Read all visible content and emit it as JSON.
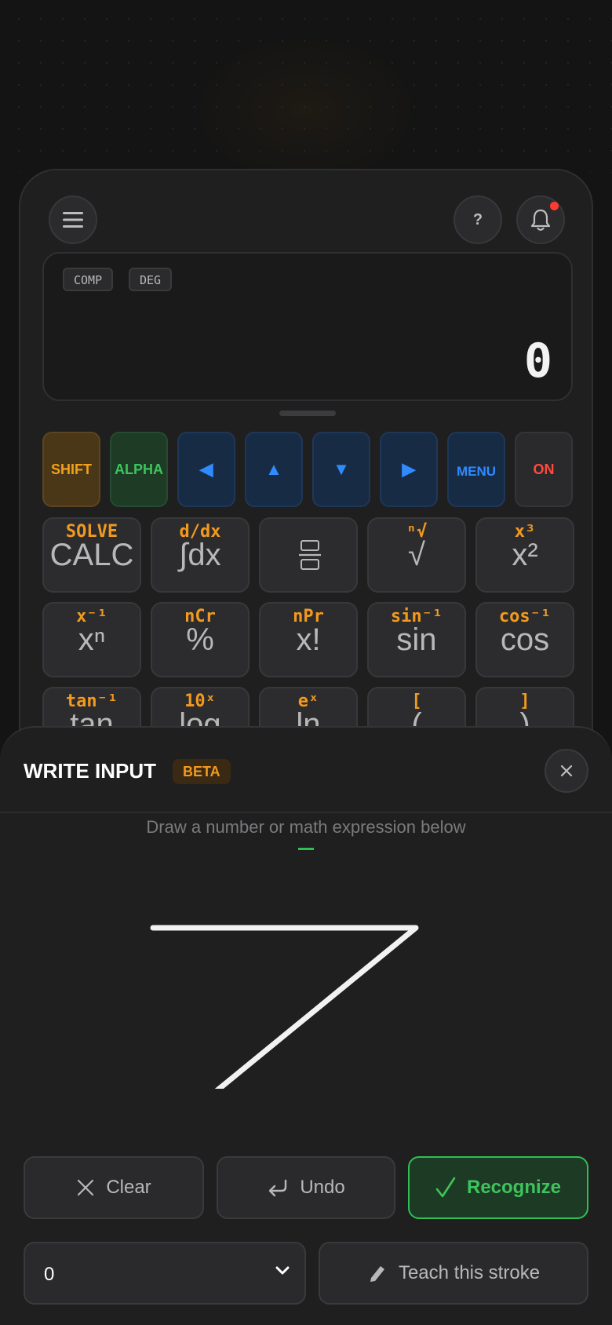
{
  "header": {
    "menu_icon": "hamburger-icon",
    "help_label": "?",
    "bell_icon": "bell-icon"
  },
  "display": {
    "mode_tags": [
      "COMP",
      "DEG"
    ],
    "value": "0"
  },
  "top_keys": [
    {
      "label": "SHIFT"
    },
    {
      "label": "ALPHA"
    },
    {
      "label": "◀"
    },
    {
      "label": "▲"
    },
    {
      "label": "▼"
    },
    {
      "label": "▶"
    },
    {
      "label": "MENU"
    },
    {
      "label": "ON"
    }
  ],
  "key_rows": [
    [
      {
        "sec": "SOLVE",
        "main": "CALC"
      },
      {
        "sec": "d/dx",
        "main": "∫dx"
      },
      {
        "sec": "",
        "main": ""
      },
      {
        "sec": "ⁿ√",
        "main": "√"
      },
      {
        "sec": "x³",
        "main": "x²"
      }
    ],
    [
      {
        "sec": "x⁻¹",
        "main": "xⁿ"
      },
      {
        "sec": "nCr",
        "main": "%"
      },
      {
        "sec": "nPr",
        "main": "x!"
      },
      {
        "sec": "sin⁻¹",
        "main": "sin"
      },
      {
        "sec": "cos⁻¹",
        "main": "cos"
      }
    ],
    [
      {
        "sec": "tan⁻¹",
        "main": "tan"
      },
      {
        "sec": "10ˣ",
        "main": "log"
      },
      {
        "sec": "eˣ",
        "main": "ln"
      },
      {
        "sec": "[",
        "main": "("
      },
      {
        "sec": "]",
        "main": ")"
      }
    ]
  ],
  "sheet": {
    "title": "WRITE INPUT",
    "badge": "BETA",
    "hint": "Draw a number or math expression below",
    "preview": "",
    "buttons": {
      "clear": "Clear",
      "undo": "Undo",
      "recognize": "Recognize",
      "teach": "Teach this stroke"
    },
    "select_value": "0"
  },
  "colors": {
    "accent_orange": "#f29a1e",
    "accent_green": "#3ec45d",
    "accent_blue": "#2f8bff",
    "danger": "#ff4a3d"
  }
}
